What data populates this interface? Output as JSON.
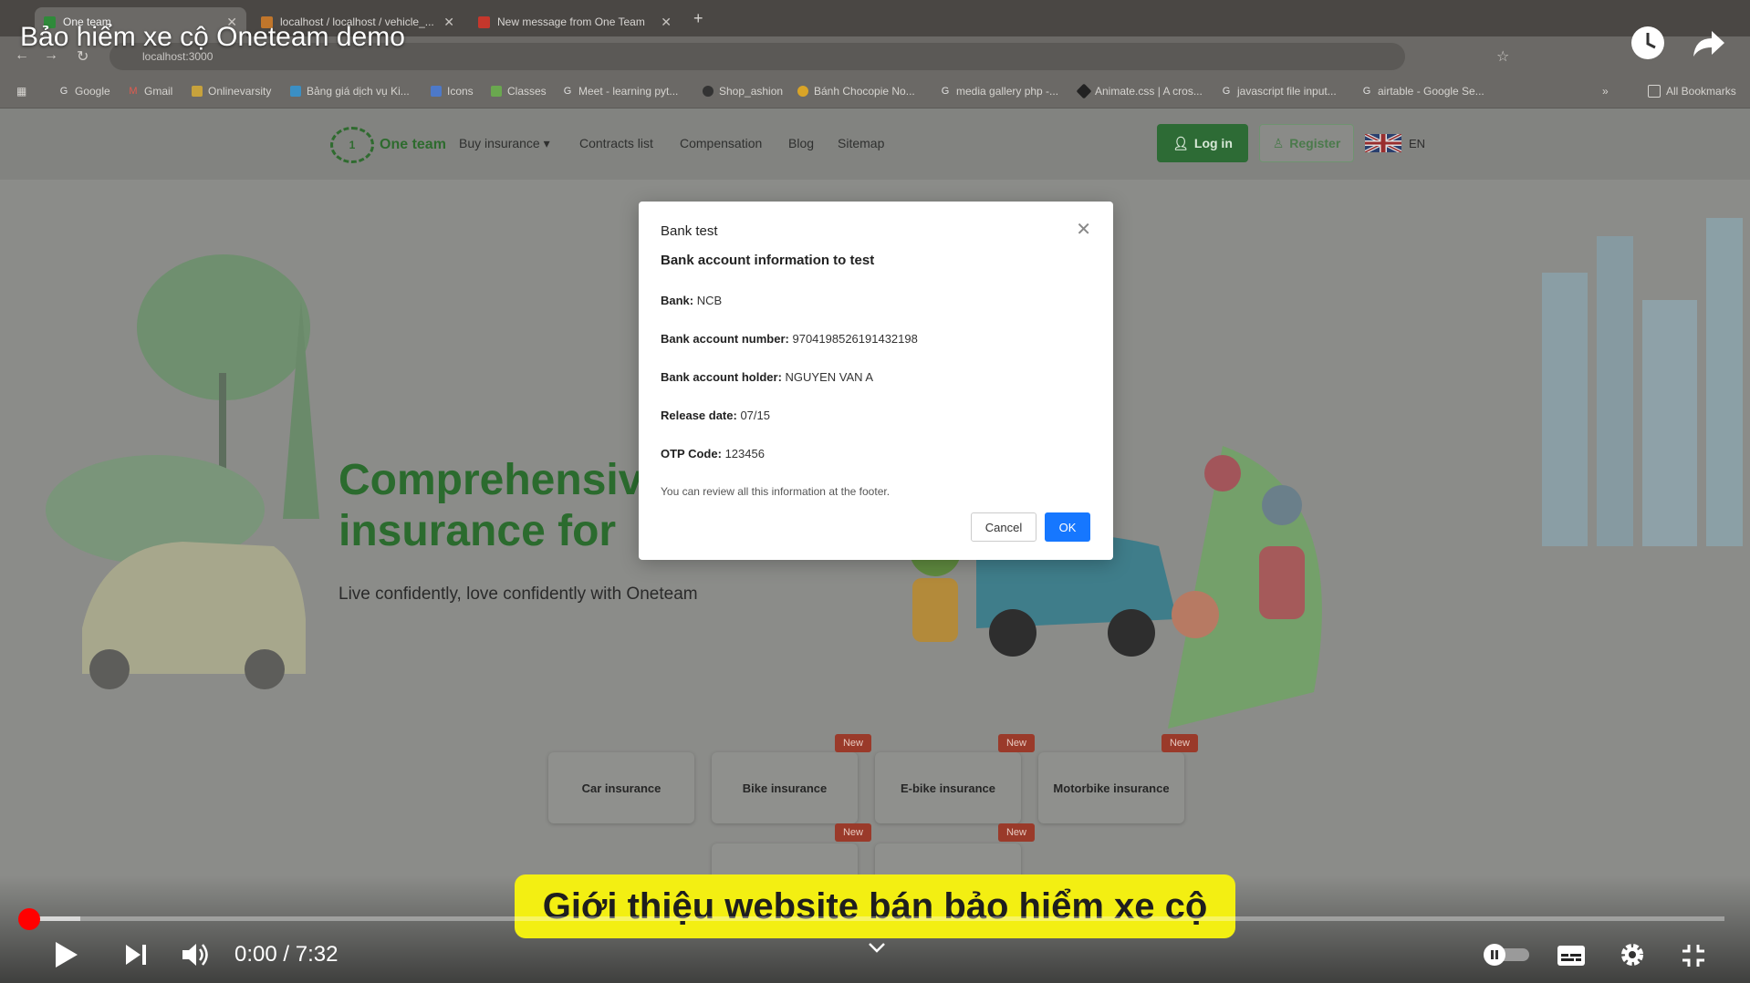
{
  "video": {
    "title": "Bảo hiểm xe cộ Oneteam demo",
    "caption": "Giới thiệu website bán bảo hiểm xe cộ",
    "time_current": "0:00",
    "time_separator": "/",
    "time_total": "7:32",
    "progress_buffered": 0.03
  },
  "browser": {
    "tabs": [
      {
        "label": "One team"
      },
      {
        "label": "localhost / localhost / vehicle_..."
      },
      {
        "label": "New message from One Team"
      }
    ],
    "address": "localhost:3000",
    "bookmarks": [
      "Google",
      "Gmail",
      "Onlinevarsity",
      "Bảng giá dịch vụ Ki...",
      "Icons",
      "Classes",
      "Meet - learning pyt...",
      "Shop_ashion",
      "Bánh Chocopie No...",
      "media gallery php -...",
      "Animate.css | A cros...",
      "javascript file input...",
      "airtable - Google Se...",
      "All Bookmarks"
    ]
  },
  "site": {
    "logo_text": "One team",
    "menu": [
      "Buy insurance",
      "Contracts list",
      "Compensation",
      "Blog",
      "Sitemap"
    ],
    "login_label": "Log in",
    "register_label": "Register",
    "lang": "EN",
    "hero_line1": "Comprehensiv",
    "hero_line2": "insurance for",
    "hero_sub": "Live confidently, love confidently with Oneteam",
    "cards": [
      "Car insurance",
      "Bike insurance",
      "E-bike insurance",
      "Motorbike insurance"
    ],
    "badge": "New"
  },
  "modal": {
    "title": "Bank test",
    "heading": "Bank account information to test",
    "rows": [
      {
        "label": "Bank:",
        "value": "NCB"
      },
      {
        "label": "Bank account number:",
        "value": "9704198526191432198"
      },
      {
        "label": "Bank account holder:",
        "value": "NGUYEN VAN A"
      },
      {
        "label": "Release date:",
        "value": "07/15"
      },
      {
        "label": "OTP Code:",
        "value": "123456"
      }
    ],
    "note": "You can review all this information at the footer.",
    "cancel": "Cancel",
    "ok": "OK"
  }
}
